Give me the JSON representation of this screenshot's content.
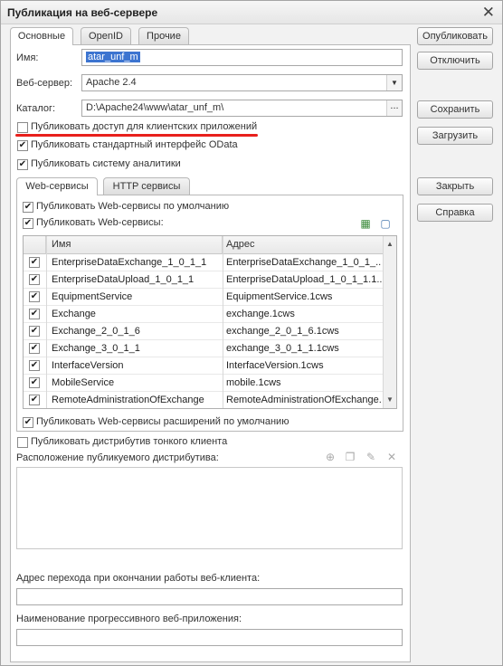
{
  "window": {
    "title": "Публикация на веб-сервере"
  },
  "tabs": [
    "Основные",
    "OpenID",
    "Прочие"
  ],
  "form": {
    "name_label": "Имя:",
    "name_value": "atar_unf_m",
    "server_label": "Веб-сервер:",
    "server_value": "Apache 2.4",
    "catalog_label": "Каталог:",
    "catalog_value": "D:\\Apache24\\www\\atar_unf_m\\",
    "catalog_btn": "..."
  },
  "options": {
    "client_apps": "Публиковать доступ для клиентских приложений",
    "odata": "Публиковать стандартный интерфейс OData",
    "analytics": "Публиковать систему аналитики"
  },
  "inner_tabs": [
    "Web-сервисы",
    "HTTP сервисы"
  ],
  "web": {
    "default": "Публиковать Web-сервисы по умолчанию",
    "publish": "Публиковать Web-сервисы:",
    "ext_default": "Публиковать Web-сервисы расширений по умолчанию"
  },
  "table": {
    "columns": [
      "Имя",
      "Адрес"
    ],
    "rows": [
      {
        "name": "EnterpriseDataExchange_1_0_1_1",
        "address": "EnterpriseDataExchange_1_0_1_..."
      },
      {
        "name": "EnterpriseDataUpload_1_0_1_1",
        "address": "EnterpriseDataUpload_1_0_1_1.1..."
      },
      {
        "name": "EquipmentService",
        "address": "EquipmentService.1cws"
      },
      {
        "name": "Exchange",
        "address": "exchange.1cws"
      },
      {
        "name": "Exchange_2_0_1_6",
        "address": "exchange_2_0_1_6.1cws"
      },
      {
        "name": "Exchange_3_0_1_1",
        "address": "exchange_3_0_1_1.1cws"
      },
      {
        "name": "InterfaceVersion",
        "address": "InterfaceVersion.1cws"
      },
      {
        "name": "MobileService",
        "address": "mobile.1cws"
      },
      {
        "name": "RemoteAdministrationOfExchange",
        "address": "RemoteAdministrationOfExchange..."
      }
    ]
  },
  "thin": {
    "publish": "Публиковать дистрибутив тонкого клиента",
    "location": "Расположение публикуемого дистрибутива:"
  },
  "bottom": {
    "redirect_label": "Адрес перехода при окончании работы веб-клиента:",
    "pwa_label": "Наименование прогрессивного веб-приложения:"
  },
  "buttons": {
    "publish": "Опубликовать",
    "unpublish": "Отключить",
    "save": "Сохранить",
    "load": "Загрузить",
    "close": "Закрыть",
    "help": "Справка"
  },
  "colors": {
    "underline": "#e8201c",
    "selection": "#3c74d0"
  }
}
